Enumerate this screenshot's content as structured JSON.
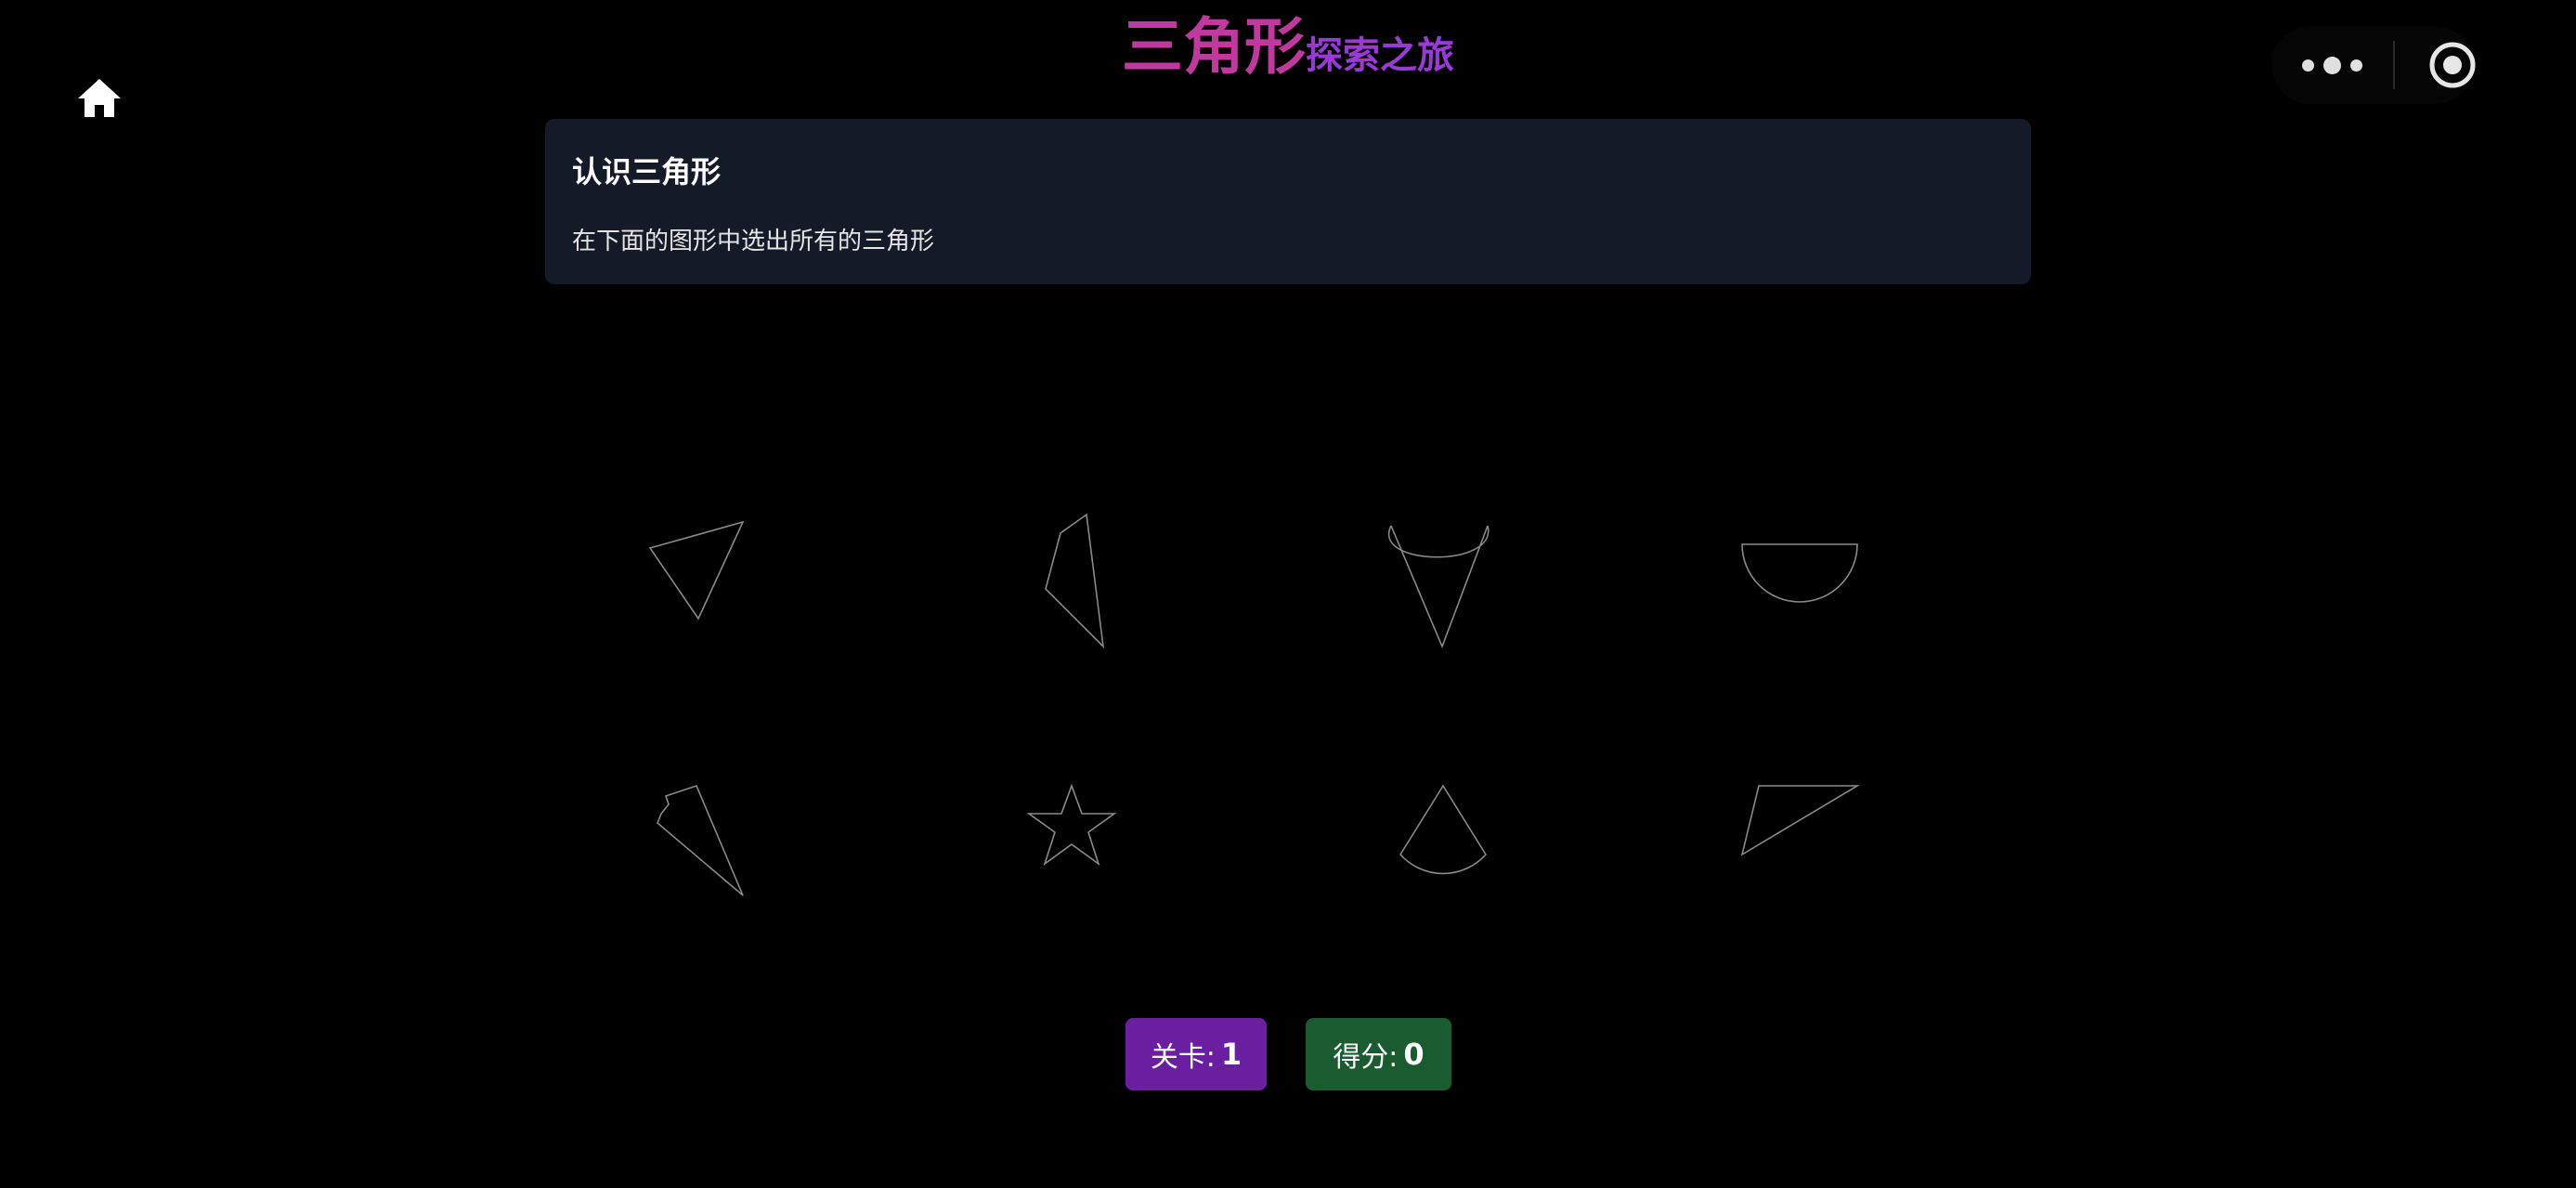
{
  "header": {
    "title_main": "三角形",
    "title_sub": "探索之旅"
  },
  "nav": {
    "home_icon": "home-icon",
    "more_icon": "more-dots-icon",
    "close_icon": "target-close-icon"
  },
  "task": {
    "title": "认识三角形",
    "description": "在下面的图形中选出所有的三角形"
  },
  "shapes": [
    {
      "kind": "triangle"
    },
    {
      "kind": "quadrilateral"
    },
    {
      "kind": "open-curve-with-lines"
    },
    {
      "kind": "semicircle"
    },
    {
      "kind": "notched-triangle"
    },
    {
      "kind": "star"
    },
    {
      "kind": "circular-sector"
    },
    {
      "kind": "triangle"
    }
  ],
  "status": {
    "level_label": "关卡:",
    "level_value": "1",
    "score_label": "得分:",
    "score_value": "0"
  },
  "colors": {
    "background": "#000000",
    "card": "#151a28",
    "title_main": "#c0399e",
    "title_sub": "#9a3ad6",
    "level_badge": "#6a1fa0",
    "score_badge": "#1a5c30",
    "shape_stroke": "#8a8a8a"
  }
}
